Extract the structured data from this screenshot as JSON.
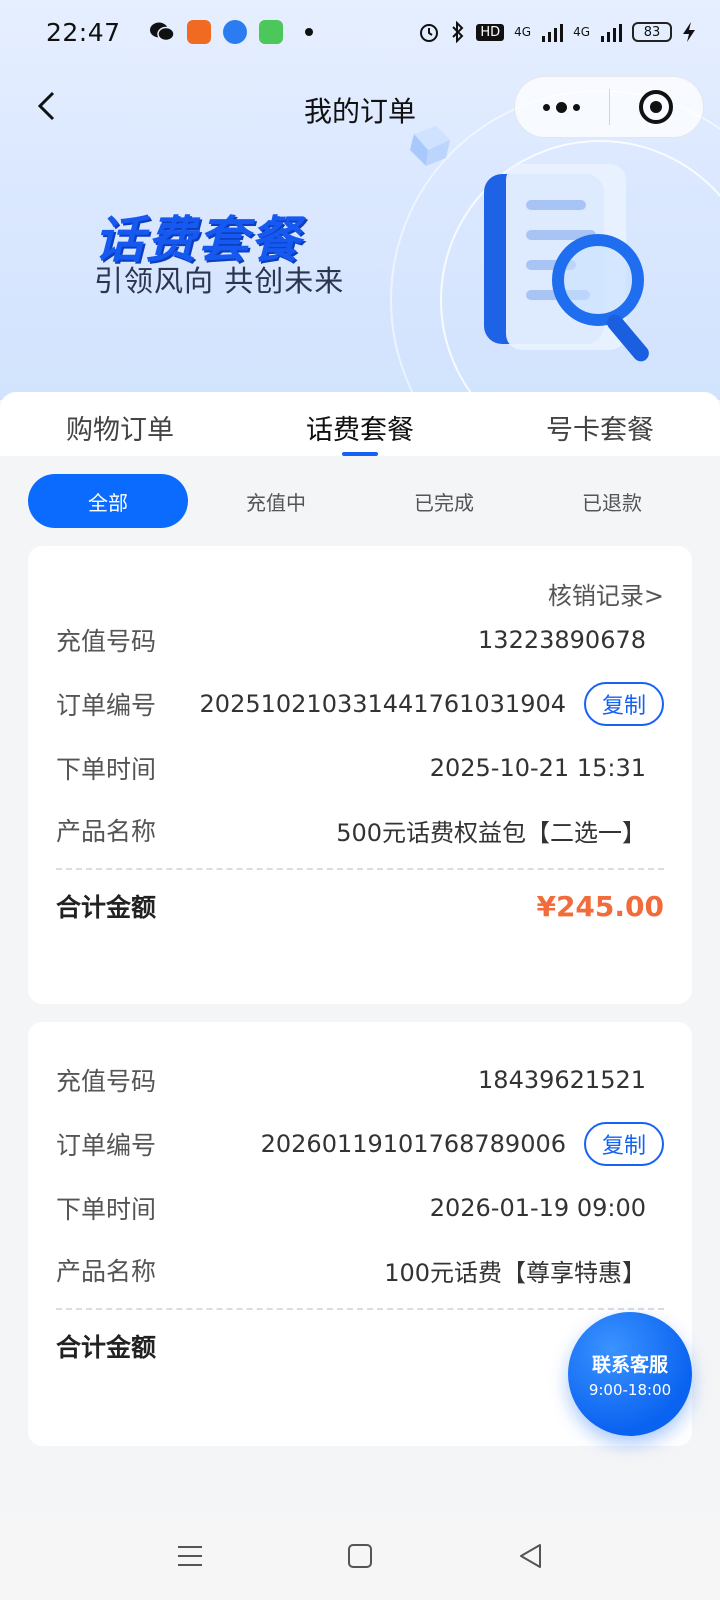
{
  "status_bar": {
    "time": "22:47",
    "battery": "83",
    "network_1": "4G",
    "network_2": "4G",
    "hd_badge": "HD"
  },
  "nav": {
    "title": "我的订单"
  },
  "banner": {
    "title": "话费套餐",
    "subtitle": "引领风向 共创未来"
  },
  "tabs": [
    {
      "label": "购物订单"
    },
    {
      "label": "话费套餐"
    },
    {
      "label": "号卡套餐"
    }
  ],
  "filters": [
    {
      "label": "全部"
    },
    {
      "label": "充值中"
    },
    {
      "label": "已完成"
    },
    {
      "label": "已退款"
    }
  ],
  "orders": [
    {
      "verify_link": "核销记录>",
      "phone_label": "充值号码",
      "phone": "13223890678",
      "order_no_label": "订单编号",
      "order_no": "20251021033144176103190­4",
      "copy_label": "复制",
      "time_label": "下单时间",
      "time": "2025-10-21 15:31",
      "product_label": "产品名称",
      "product": "500元话费权益包【二选一】",
      "total_label": "合计金额",
      "total": "¥245.00"
    },
    {
      "phone_label": "充值号码",
      "phone": "18439621521",
      "order_no_label": "订单编号",
      "order_no": "20260119101768789006",
      "copy_label": "复制",
      "time_label": "下单时间",
      "time": "2026-01-19 09:00",
      "product_label": "产品名称",
      "product": "100元话费【尊享特惠】",
      "total_label": "合计金额",
      "total": "¥"
    }
  ],
  "service": {
    "label": "联系客服",
    "hours": "9:00-18:00"
  },
  "colors": {
    "accent": "#1662f5",
    "chip_active": "#0b6bff",
    "price": "#f26b3a"
  }
}
